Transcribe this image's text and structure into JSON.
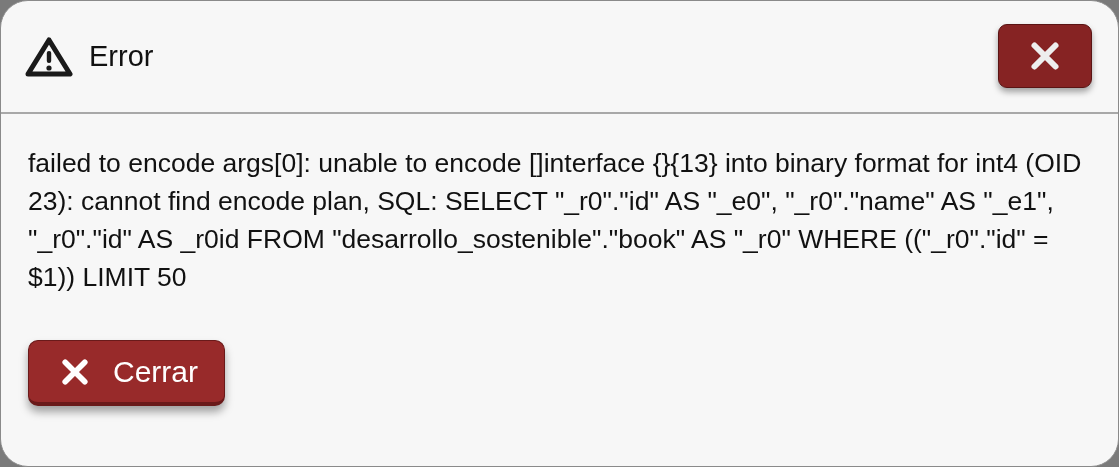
{
  "dialog": {
    "title": "Error",
    "message": "failed to encode args[0]: unable to encode []interface {}{13} into binary format for int4 (OID 23): cannot find encode plan, SQL: SELECT \"_r0\".\"id\" AS \"_e0\", \"_r0\".\"name\" AS \"_e1\", \"_r0\".\"id\" AS _r0id FROM \"desarrollo_sostenible\".\"book\" AS \"_r0\" WHERE ((\"_r0\".\"id\" = $1)) LIMIT 50",
    "close_button": "Cerrar"
  }
}
